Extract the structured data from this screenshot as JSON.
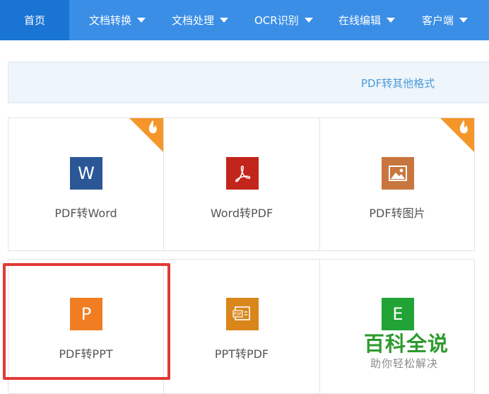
{
  "nav": {
    "items": [
      {
        "label": "首页",
        "active": true
      },
      {
        "label": "文档转换",
        "dropdown": true
      },
      {
        "label": "文档处理",
        "dropdown": true
      },
      {
        "label": "OCR识别",
        "dropdown": true
      },
      {
        "label": "在线编辑",
        "dropdown": true
      },
      {
        "label": "客户端",
        "dropdown": true
      }
    ]
  },
  "banner": {
    "text": "PDF转其他格式"
  },
  "tools": [
    {
      "label": "PDF转Word",
      "icon": "word-icon",
      "color": "#2b5797",
      "glyph": "W",
      "hot": true
    },
    {
      "label": "Word转PDF",
      "icon": "pdf-acrobat-icon",
      "color": "#c2251b",
      "hot": false
    },
    {
      "label": "PDF转图片",
      "icon": "image-icon",
      "color": "#c8763d",
      "hot": true
    },
    {
      "label": "PDF转PPT",
      "icon": "ppt-icon",
      "color": "#f07d21",
      "glyph": "P",
      "hot": false
    },
    {
      "label": "PPT转PDF",
      "icon": "ppt-to-pdf-icon",
      "color": "#d9861b",
      "hot": false
    },
    {
      "label": "",
      "icon": "excel-icon",
      "color": "#21a336",
      "glyph": "E",
      "hot": false
    }
  ],
  "watermark": {
    "title": "百科全说",
    "subtitle": "助你轻松解决"
  },
  "colors": {
    "nav_bg": "#3a8ee6",
    "nav_active": "#1a74d4",
    "banner_bg": "#eef5fb",
    "banner_text": "#4a9bd9",
    "hot_badge": "#f5962a",
    "highlight": "#e23a35",
    "watermark": "#2e9a2e"
  }
}
